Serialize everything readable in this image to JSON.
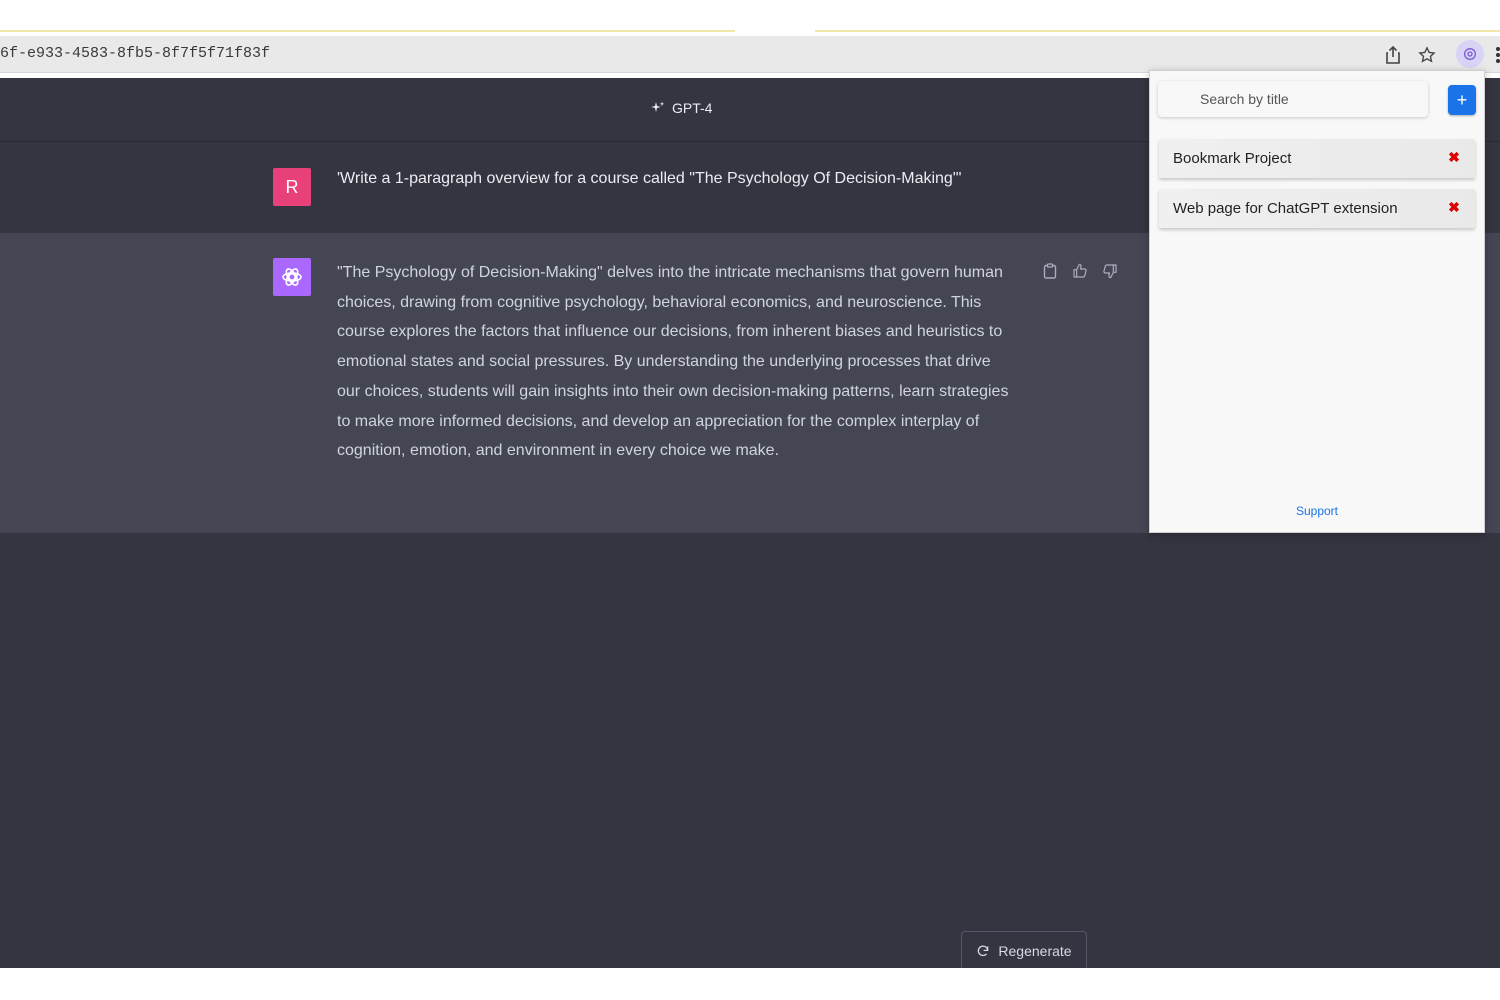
{
  "browser": {
    "url": "6f-e933-4583-8fb5-8f7f5f71f83f",
    "icons": [
      "share-icon",
      "star-icon",
      "extension-icon",
      "more-icon"
    ]
  },
  "chat": {
    "model": "GPT-4",
    "user_avatar": "R",
    "user_message": "'Write a 1-paragraph overview for a course called \"The Psychology Of Decision-Making\"'",
    "assistant_message": "\"The Psychology of Decision-Making\" delves into the intricate mechanisms that govern human choices, drawing from cognitive psychology, behavioral economics, and neuroscience. This course explores the factors that influence our decisions, from inherent biases and heuristics to emotional states and social pressures. By understanding the underlying processes that drive our choices, students will gain insights into their own decision-making patterns, learn strategies to make more informed decisions, and develop an appreciation for the complex interplay of cognition, emotion, and environment in every choice we make.",
    "regenerate_label": "Regenerate"
  },
  "popup": {
    "search_placeholder": "Search by title",
    "add_label": "+",
    "bookmarks": [
      {
        "title": "Bookmark Project"
      },
      {
        "title": "Web page for ChatGPT extension"
      }
    ],
    "delete_glyph": "✖",
    "support_label": "Support"
  },
  "colors": {
    "app_bg": "#343541",
    "assistant_bg": "#444654",
    "user_avatar": "#e8417a",
    "gpt_avatar": "#ab68ff",
    "accent": "#1a73e8"
  }
}
